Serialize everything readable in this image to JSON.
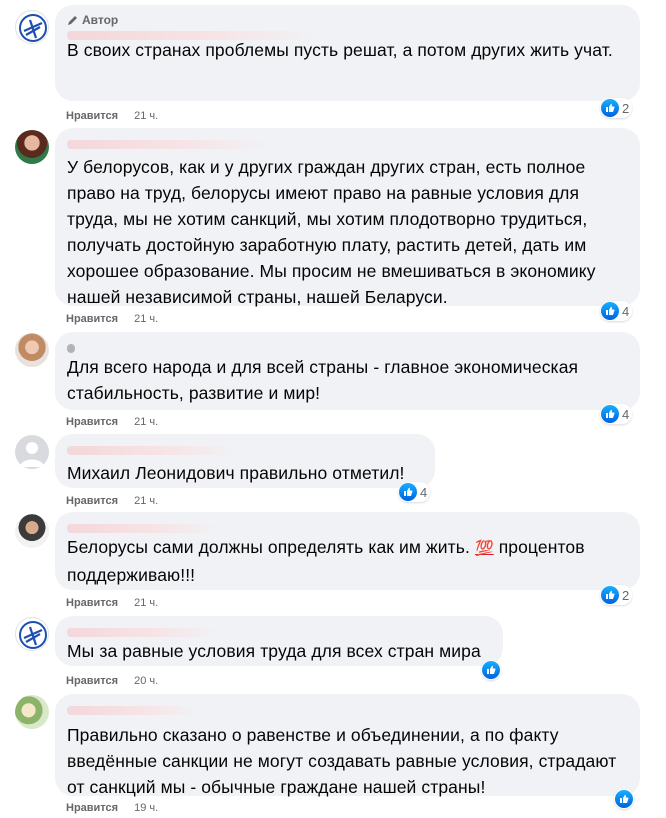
{
  "author_badge": "Автор",
  "like_label": "Нравится",
  "comments": [
    {
      "text": "В своих странах проблемы пусть решат, а потом других жить учат.",
      "time": "21 ч.",
      "reactions": "2"
    },
    {
      "text": "У белорусов, как и у других граждан других стран, есть полное право на труд, белорусы имеют право на равные условия для труда, мы не хотим санкций, мы хотим плодотворно трудиться, получать достойную заработную плату, растить детей, дать им хорошее образование. Мы просим не вмешиваться в экономику нашей независимой страны, нашей Беларуси.",
      "time": "21 ч.",
      "reactions": "4"
    },
    {
      "text": "Для всего народа и для всей страны - главное экономическая стабильность, развитие и мир!",
      "time": "21 ч.",
      "reactions": "4"
    },
    {
      "text": "Михаил Леонидович правильно отметил!",
      "time": "21 ч.",
      "reactions": "4"
    },
    {
      "text_before": "Белорусы сами должны определять как им жить.",
      "emoji": "💯",
      "text_after": "процентов поддерживаю!!!",
      "time": "21 ч.",
      "reactions": "2"
    },
    {
      "text": "Мы за равные условия труда для всех стран мира",
      "time": "20 ч.",
      "reactions": ""
    },
    {
      "text": "Правильно сказано о равенстве и объединении, а по факту введённые санкции не могут создавать равные условия, страдают от санкций мы - обычные граждане нашей страны!",
      "time": "19 ч.",
      "reactions": ""
    }
  ]
}
